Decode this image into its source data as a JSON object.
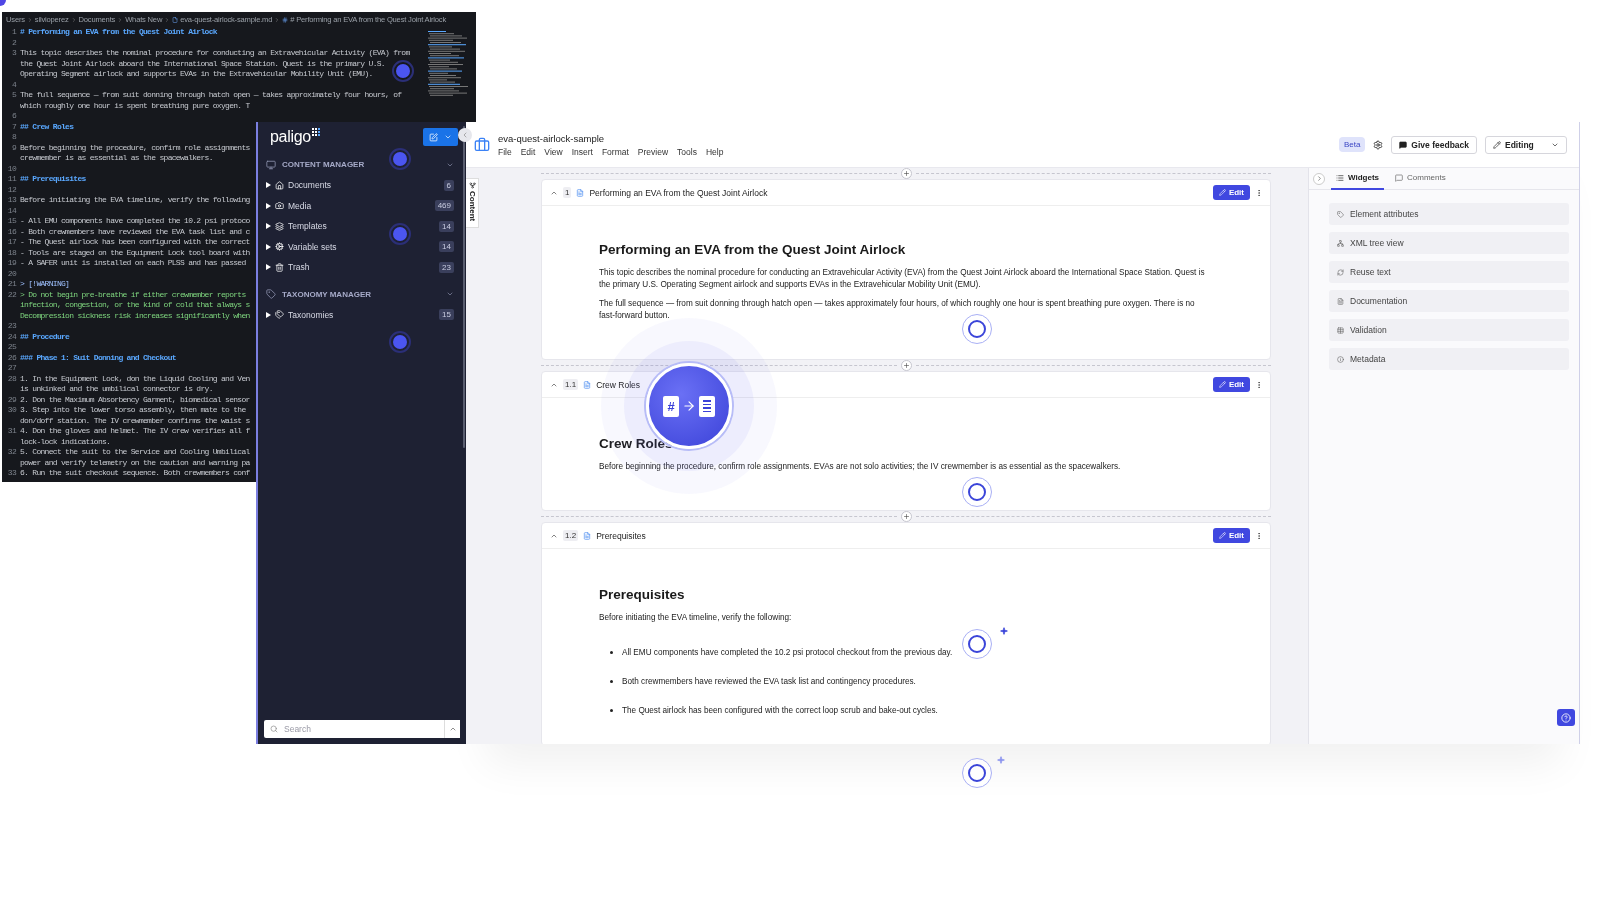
{
  "code_editor": {
    "breadcrumb": [
      {
        "kind": "folder",
        "label": "Users"
      },
      {
        "kind": "folder",
        "label": "silvioperez"
      },
      {
        "kind": "folder",
        "label": "Documents"
      },
      {
        "kind": "folder",
        "label": "Whats New"
      },
      {
        "kind": "file",
        "label": "eva-quest-airlock-sample.md"
      },
      {
        "kind": "symbol",
        "label": "# Performing an EVA from the Quest Joint Airlock"
      }
    ],
    "lines": [
      {
        "number": "1",
        "kind": "heading",
        "rows": [
          "# Performing an EVA from the Quest Joint Airlock"
        ]
      },
      {
        "number": "2",
        "kind": "blank"
      },
      {
        "number": "3",
        "kind": "text",
        "rows": [
          "This topic describes the nominal procedure for conducting an Extravehicular Activity (EVA) from",
          "the Quest Joint Airlock aboard the International Space Station. Quest is the primary U.S.",
          "Operating Segment airlock and supports EVAs in the Extravehicular Mobility Unit (EMU)."
        ]
      },
      {
        "number": "4",
        "kind": "blank"
      },
      {
        "number": "5",
        "kind": "text",
        "rows": [
          "The full sequence — from suit donning through hatch open — takes approximately four hours, of",
          "which roughly one hour is spent breathing pure oxygen. T"
        ]
      },
      {
        "number": "6",
        "kind": "blank"
      },
      {
        "number": "7",
        "kind": "heading",
        "rows": [
          "## Crew Roles"
        ]
      },
      {
        "number": "8",
        "kind": "blank"
      },
      {
        "number": "9",
        "kind": "text",
        "rows": [
          "Before beginning the procedure, confirm role assignments",
          "crewmember is as essential as the spacewalkers."
        ]
      },
      {
        "number": "10",
        "kind": "blank"
      },
      {
        "number": "11",
        "kind": "heading",
        "rows": [
          "## Prerequisites"
        ]
      },
      {
        "number": "12",
        "kind": "blank"
      },
      {
        "number": "13",
        "kind": "text",
        "rows": [
          "Before initiating the EVA timeline, verify the following"
        ]
      },
      {
        "number": "14",
        "kind": "blank"
      },
      {
        "number": "15",
        "kind": "text",
        "rows": [
          "- All EMU components have completed the 10.2 psi protoco"
        ]
      },
      {
        "number": "16",
        "kind": "text",
        "rows": [
          "- Both crewmembers have reviewed the EVA task list and c"
        ]
      },
      {
        "number": "17",
        "kind": "text",
        "rows": [
          "- The Quest airlock has been configured with the correct"
        ]
      },
      {
        "number": "18",
        "kind": "text",
        "rows": [
          "- Tools are staged on the Equipment Lock tool board with"
        ]
      },
      {
        "number": "19",
        "kind": "text",
        "rows": [
          "- A SAFER unit is installed on each PLSS and has passed"
        ]
      },
      {
        "number": "20",
        "kind": "blank"
      },
      {
        "number": "21",
        "kind": "callout",
        "rows": [
          "> [!WARNING]"
        ]
      },
      {
        "number": "22",
        "kind": "quote",
        "rows": [
          "> Do not begin pre-breathe if either crewmember reports",
          "infection, congestion, or the kind of cold that always s",
          "Decompression sickness risk increases significantly when"
        ]
      },
      {
        "number": "23",
        "kind": "blank"
      },
      {
        "number": "24",
        "kind": "heading",
        "rows": [
          "## Procedure"
        ]
      },
      {
        "number": "25",
        "kind": "blank"
      },
      {
        "number": "26",
        "kind": "heading",
        "rows": [
          "### Phase 1: Suit Donning and Checkout"
        ]
      },
      {
        "number": "27",
        "kind": "blank"
      },
      {
        "number": "28",
        "kind": "text",
        "rows": [
          "1. In the Equipment Lock, don the Liquid Cooling and Ven",
          "is unkinked and the umbilical connector is dry."
        ]
      },
      {
        "number": "29",
        "kind": "text",
        "rows": [
          "2. Don the Maximum Absorbency Garment, biomedical sensor"
        ]
      },
      {
        "number": "30",
        "kind": "text",
        "rows": [
          "3. Step into the lower torso assembly, then mate to the",
          "don/doff station. The IV crewmember confirms the waist s"
        ]
      },
      {
        "number": "31",
        "kind": "text",
        "rows": [
          "4. Don the gloves and helmet. The IV crew verifies all f",
          "lock-lock indications."
        ]
      },
      {
        "number": "32",
        "kind": "text",
        "rows": [
          "5. Connect the suit to the Service and Cooling Umbilical",
          "power and verify telemetry on the caution and warning pa"
        ]
      },
      {
        "number": "33",
        "kind": "text",
        "rows": [
          "6. Run the suit checkout sequence. Both crewmembers conf"
        ]
      }
    ]
  },
  "sidebar": {
    "logo": "paligo",
    "sections": [
      {
        "title": "CONTENT MANAGER",
        "expanded": true,
        "items": [
          {
            "label": "Documents",
            "count": "6",
            "expanded": false
          },
          {
            "label": "Media",
            "count": "469",
            "expanded": false
          },
          {
            "label": "Templates",
            "count": "14",
            "expanded": false
          },
          {
            "label": "Variable sets",
            "count": "14",
            "expanded": false
          },
          {
            "label": "Trash",
            "count": "23",
            "expanded": false
          }
        ]
      },
      {
        "title": "TAXONOMY MANAGER",
        "expanded": true,
        "items": [
          {
            "label": "Taxonomies",
            "count": "15",
            "expanded": false
          }
        ]
      }
    ],
    "search": {
      "placeholder": "Search"
    }
  },
  "app": {
    "document_title": "eva-quest-airlock-sample",
    "menu": [
      "File",
      "Edit",
      "View",
      "Insert",
      "Format",
      "Preview",
      "Tools",
      "Help"
    ],
    "badge": "Beta",
    "feedback_button": "Give feedback",
    "mode_button": "Editing",
    "content_tab": "Content"
  },
  "topics": [
    {
      "number": "1",
      "title": "Performing an EVA from the Quest Joint Airlock",
      "expanded": true,
      "edit_button": "Edit",
      "heading": "Performing an EVA from the Quest Joint Airlock",
      "paragraphs": [
        "This topic describes the nominal procedure for conducting an Extravehicular Activity (EVA) from the Quest Joint Airlock aboard the International Space Station. Quest is the primary U.S. Operating Segment airlock and supports EVAs in the Extravehicular Mobility Unit (EMU).",
        "The full sequence — from suit donning through hatch open — takes approximately four hours, of which roughly one hour is spent breathing pure oxygen. There is no fast-forward button."
      ]
    },
    {
      "number": "1.1",
      "title": "Crew Roles",
      "expanded": true,
      "edit_button": "Edit",
      "heading": "Crew Roles",
      "paragraphs": [
        "Before beginning the procedure, confirm role assignments. EVAs are not solo activities; the IV crewmember is as essential as the spacewalkers."
      ]
    },
    {
      "number": "1.2",
      "title": "Prerequisites",
      "expanded": true,
      "edit_button": "Edit",
      "heading": "Prerequisites",
      "paragraphs": [
        "Before initiating the EVA timeline, verify the following:"
      ],
      "bullets": [
        "All EMU components have completed the 10.2 psi protocol checkout from the previous day.",
        "Both crewmembers have reviewed the EVA task list and contingency procedures.",
        "The Quest airlock has been configured with the correct loop scrub and bake-out cycles."
      ]
    }
  ],
  "widgets_panel": {
    "tabs": [
      {
        "label": "Widgets",
        "selected": true
      },
      {
        "label": "Comments",
        "selected": false
      }
    ],
    "items": [
      {
        "label": "Element attributes"
      },
      {
        "label": "XML tree view"
      },
      {
        "label": "Reuse text"
      },
      {
        "label": "Documentation"
      },
      {
        "label": "Validation"
      },
      {
        "label": "Metadata"
      }
    ]
  },
  "conversion_badge": {
    "symbol": "#"
  }
}
